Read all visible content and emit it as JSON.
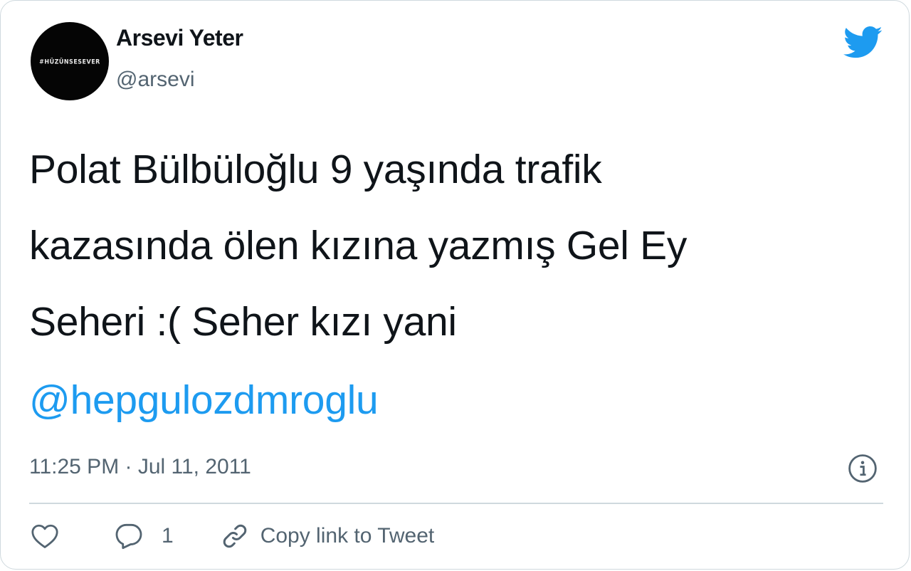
{
  "author": {
    "display_name": "Arsevi Yeter",
    "handle": "@arsevi",
    "avatar_text": "#HÜZÜNSESEVER"
  },
  "tweet": {
    "lines": [
      "Polat Bülbüloğlu 9 yaşında trafik",
      "kazasında ölen kızına yazmış Gel Ey",
      "Seheri :( Seher kızı yani"
    ],
    "mention": "@hepgulozdmroglu",
    "timestamp": "11:25 PM · Jul 11, 2011"
  },
  "actions": {
    "reply_count": "1",
    "copy_link_label": "Copy link to Tweet"
  },
  "icons": {
    "brand": "twitter-bird-icon",
    "info": "info-icon",
    "like": "heart-icon",
    "reply": "reply-bubble-icon",
    "copy": "link-icon"
  },
  "colors": {
    "brand_blue": "#1d9bf0",
    "text": "#0f1419",
    "secondary": "#536471",
    "border": "#cfd9de"
  }
}
